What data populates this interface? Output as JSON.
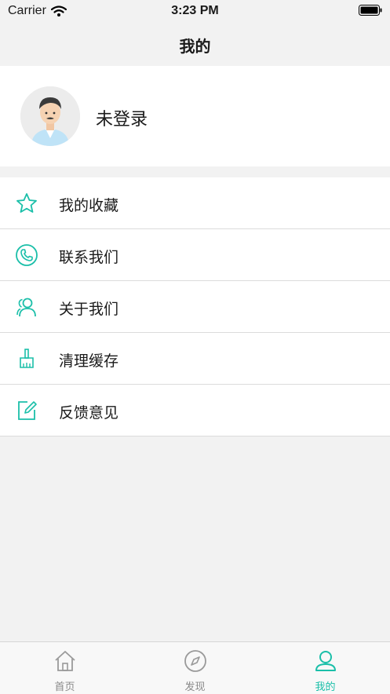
{
  "status_bar": {
    "carrier": "Carrier",
    "time": "3:23 PM"
  },
  "nav": {
    "title": "我的"
  },
  "profile": {
    "name": "未登录"
  },
  "menu": {
    "items": [
      {
        "label": "我的收藏",
        "icon": "star-icon"
      },
      {
        "label": "联系我们",
        "icon": "phone-icon"
      },
      {
        "label": "关于我们",
        "icon": "users-icon"
      },
      {
        "label": "清理缓存",
        "icon": "broom-icon"
      },
      {
        "label": "反馈意见",
        "icon": "edit-icon"
      }
    ]
  },
  "tabs": [
    {
      "label": "首页",
      "icon": "home-icon",
      "active": false
    },
    {
      "label": "发现",
      "icon": "compass-icon",
      "active": false
    },
    {
      "label": "我的",
      "icon": "user-icon",
      "active": true
    }
  ],
  "colors": {
    "accent": "#1bbfa9",
    "background": "#f2f2f2",
    "inactive": "#8a8a8a"
  }
}
